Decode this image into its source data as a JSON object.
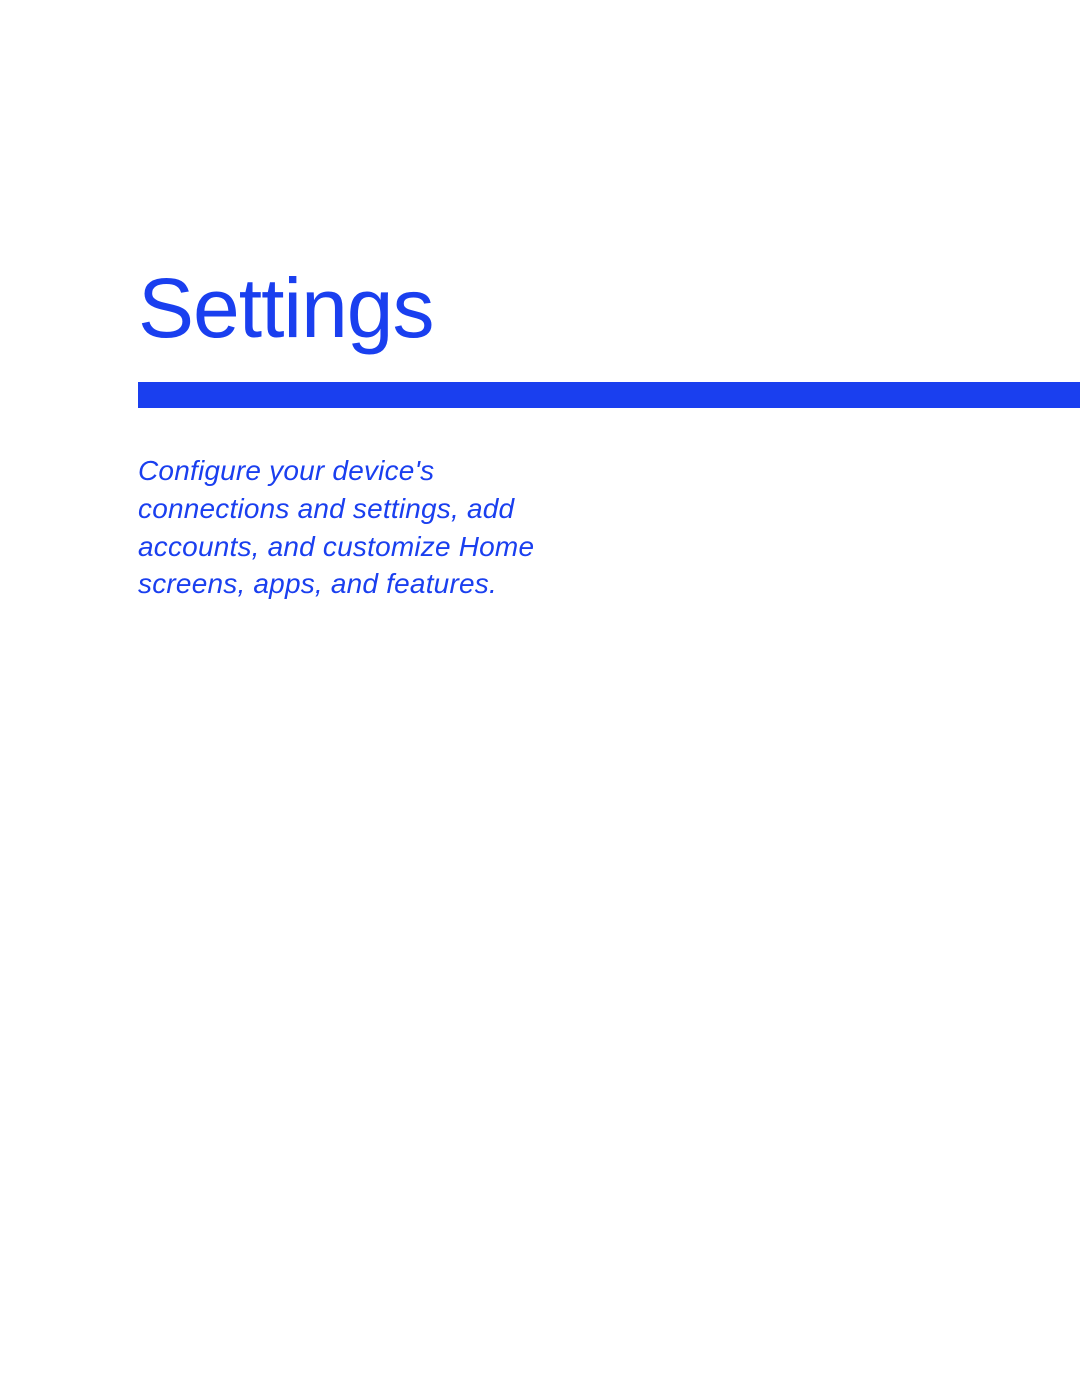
{
  "title": "Settings",
  "description": "Configure your device's connections and settings, add accounts, and customize Home screens, apps, and features.",
  "colors": {
    "accent": "#1a3fef"
  }
}
